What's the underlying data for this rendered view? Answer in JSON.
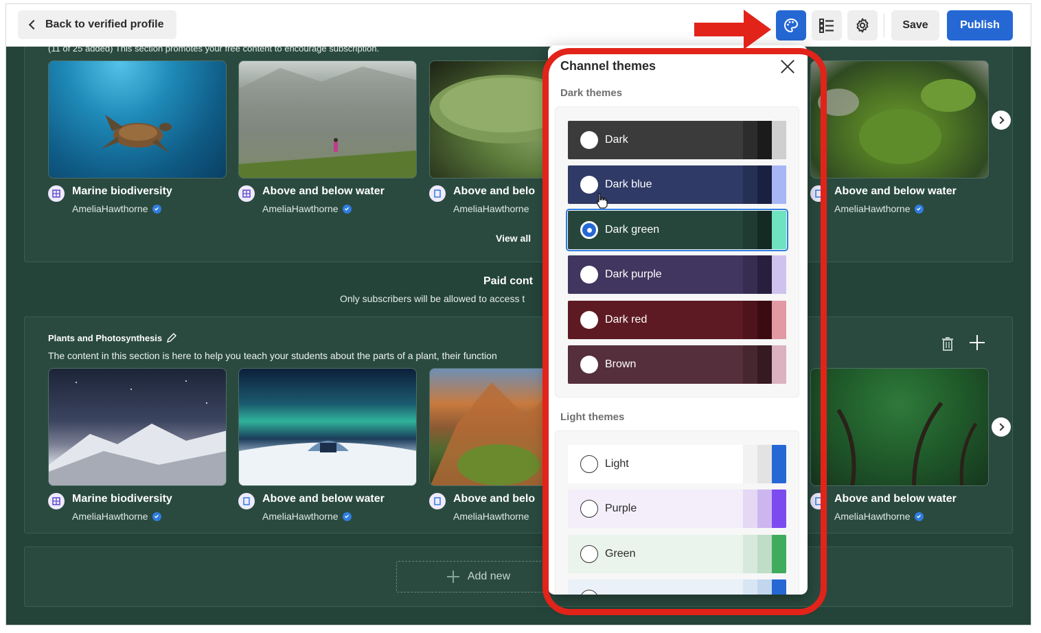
{
  "topbar": {
    "back_label": "Back to verified profile",
    "save_label": "Save",
    "publish_label": "Publish",
    "icons": [
      "palette-icon",
      "list-icon",
      "gear-icon"
    ]
  },
  "section1": {
    "note": "(11 of 25 added) This section promotes your free content to encourage subscription.",
    "view_all": "View all",
    "cards": [
      {
        "title": "Marine biodiversity",
        "author": "AmeliaHawthorne"
      },
      {
        "title": "Above and below water",
        "author": "AmeliaHawthorne"
      },
      {
        "title": "Above and belo",
        "author": "AmeliaHawthorne"
      },
      {
        "title": "Above and below water",
        "author": "AmeliaHawthorne"
      }
    ]
  },
  "paid": {
    "title": "Paid cont",
    "subtitle": "Only subscribers will be allowed to access t"
  },
  "section2": {
    "title": "Plants and Photosynthesis",
    "description": "The content in this section is here to help you teach your students about the parts of a plant, their function",
    "cards": [
      {
        "title": "Marine biodiversity",
        "author": "AmeliaHawthorne"
      },
      {
        "title": "Above and below water",
        "author": "AmeliaHawthorne"
      },
      {
        "title": "Above and belo",
        "author": "AmeliaHawthorne"
      },
      {
        "title": "Above and below water",
        "author": "AmeliaHawthorne"
      }
    ]
  },
  "section3": {
    "add_new_label": "Add new"
  },
  "theme_panel": {
    "title": "Channel themes",
    "dark_group": "Dark themes",
    "light_group": "Light themes",
    "selected": "Dark green",
    "dark_themes": [
      {
        "name": "Dark",
        "bg": "#3b3b3b",
        "s1": "#2c2c2c",
        "s2": "#1b1b1b",
        "s3": "#cfcfcf"
      },
      {
        "name": "Dark blue",
        "bg": "#2f3a66",
        "s1": "#263055",
        "s2": "#1a2140",
        "s3": "#a8b6f5"
      },
      {
        "name": "Dark green",
        "bg": "#26463c",
        "s1": "#1f3b32",
        "s2": "#142a23",
        "s3": "#6fe3c0"
      },
      {
        "name": "Dark purple",
        "bg": "#41365f",
        "s1": "#372d52",
        "s2": "#271f3d",
        "s3": "#cfc2ee"
      },
      {
        "name": "Dark red",
        "bg": "#5e1a22",
        "s1": "#4f141b",
        "s2": "#3a0c12",
        "s3": "#e19aa2"
      },
      {
        "name": "Brown",
        "bg": "#552f3b",
        "s1": "#482630",
        "s2": "#351a22",
        "s3": "#dcb2c0"
      }
    ],
    "light_themes": [
      {
        "name": "Light",
        "bg": "#ffffff",
        "s1": "#f2f2f2",
        "s2": "#e3e3e3",
        "s3": "#2568d4"
      },
      {
        "name": "Purple",
        "bg": "#f3eef9",
        "s1": "#e4d8f5",
        "s2": "#cdb6ef",
        "s3": "#7c4bf0"
      },
      {
        "name": "Green",
        "bg": "#eaf3ec",
        "s1": "#d7e9dc",
        "s2": "#bfddc7",
        "s3": "#3fab5c"
      },
      {
        "name": "",
        "bg": "#eaf1f9",
        "s1": "#d8e6f4",
        "s2": "#c2d7ee",
        "s3": "#2568d4"
      }
    ]
  },
  "colors": {
    "background": "#244339",
    "accent": "#2568d4",
    "annotation": "#e2231a"
  }
}
